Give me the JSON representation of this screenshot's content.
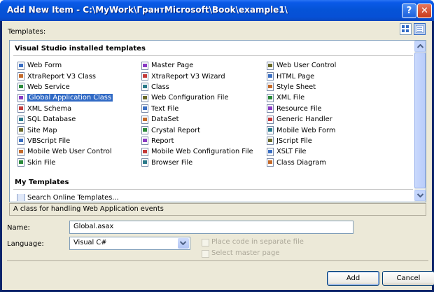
{
  "window": {
    "title": "Add New Item - C:\\MyWork\\ГрантMicrosoft\\Book\\example1\\",
    "help_glyph": "?",
    "close_glyph": "✕"
  },
  "templates_label": "Templates:",
  "view_buttons": [
    "large-icons-view-icon",
    "small-icons-view-icon"
  ],
  "installed_header": "Visual Studio installed templates",
  "my_templates_header": "My Templates",
  "columns": [
    [
      {
        "label": "Web Form",
        "icon": "web-form-icon"
      },
      {
        "label": "XtraReport V3 Class",
        "icon": "report-class-icon"
      },
      {
        "label": "Web Service",
        "icon": "web-service-icon"
      },
      {
        "label": "Global Application Class",
        "icon": "global-app-icon",
        "selected": true
      },
      {
        "label": "XML Schema",
        "icon": "xml-schema-icon"
      },
      {
        "label": "SQL Database",
        "icon": "database-icon"
      },
      {
        "label": "Site Map",
        "icon": "site-map-icon"
      },
      {
        "label": "VBScript File",
        "icon": "script-icon"
      },
      {
        "label": "Mobile Web User Control",
        "icon": "mobile-control-icon"
      },
      {
        "label": "Skin File",
        "icon": "skin-icon"
      }
    ],
    [
      {
        "label": "Master Page",
        "icon": "master-page-icon"
      },
      {
        "label": "XtraReport V3 Wizard",
        "icon": "report-wizard-icon"
      },
      {
        "label": "Class",
        "icon": "class-icon"
      },
      {
        "label": "Web Configuration File",
        "icon": "config-icon"
      },
      {
        "label": "Text File",
        "icon": "text-file-icon"
      },
      {
        "label": "DataSet",
        "icon": "dataset-icon"
      },
      {
        "label": "Crystal Report",
        "icon": "crystal-report-icon"
      },
      {
        "label": "Report",
        "icon": "report-icon"
      },
      {
        "label": "Mobile Web Configuration File",
        "icon": "config-icon"
      },
      {
        "label": "Browser File",
        "icon": "browser-icon"
      }
    ],
    [
      {
        "label": "Web User Control",
        "icon": "user-control-icon"
      },
      {
        "label": "HTML Page",
        "icon": "html-icon"
      },
      {
        "label": "Style Sheet",
        "icon": "stylesheet-icon"
      },
      {
        "label": "XML File",
        "icon": "xml-file-icon"
      },
      {
        "label": "Resource File",
        "icon": "resource-icon"
      },
      {
        "label": "Generic Handler",
        "icon": "handler-icon"
      },
      {
        "label": "Mobile Web Form",
        "icon": "mobile-form-icon"
      },
      {
        "label": "JScript File",
        "icon": "script-icon"
      },
      {
        "label": "XSLT File",
        "icon": "xslt-icon"
      },
      {
        "label": "Class Diagram",
        "icon": "class-diagram-icon"
      }
    ]
  ],
  "my_templates_partial": "Search Online Templates...",
  "description": "A class for handling Web Application events",
  "name_label": "Name:",
  "name_value": "Global.asax",
  "language_label": "Language:",
  "language_value": "Visual C#",
  "place_code_label": "Place code in separate file",
  "select_master_label": "Select master page",
  "add_label": "Add",
  "cancel_label": "Cancel",
  "colors": {
    "title_bar": "#0553d7",
    "selection": "#316ac5",
    "dialog_bg": "#ece9d8"
  }
}
